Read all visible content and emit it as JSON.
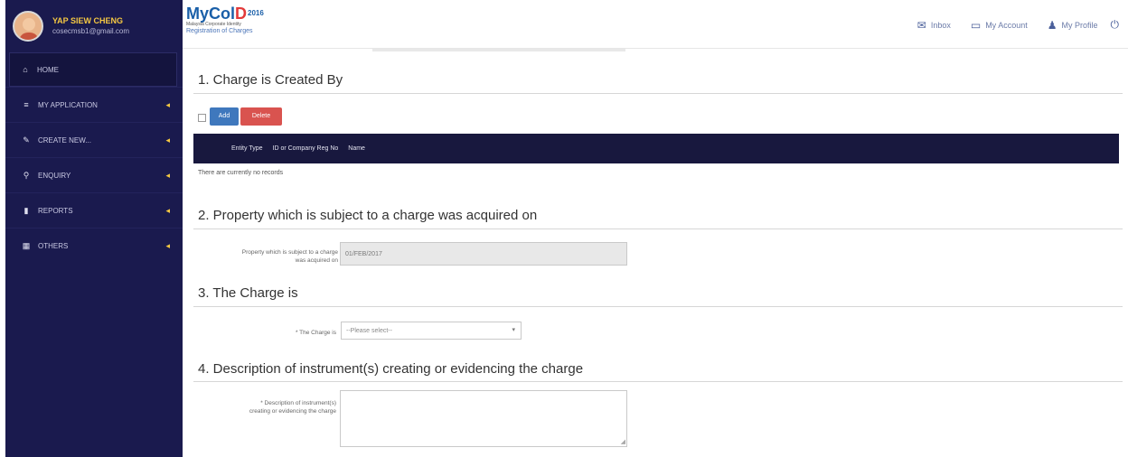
{
  "user": {
    "name": "YAP SIEW CHENG",
    "email": "cosecmsb1@gmail.com"
  },
  "sidebar": {
    "items": [
      {
        "label": "HOME",
        "icon": "home-icon",
        "has_arrow": false
      },
      {
        "label": "MY APPLICATION",
        "icon": "list-icon",
        "has_arrow": true
      },
      {
        "label": "CREATE NEW...",
        "icon": "edit-icon",
        "has_arrow": true
      },
      {
        "label": "ENQUIRY",
        "icon": "search-icon",
        "has_arrow": true
      },
      {
        "label": "REPORTS",
        "icon": "file-icon",
        "has_arrow": true
      },
      {
        "label": "OTHERS",
        "icon": "grid-icon",
        "has_arrow": true
      }
    ],
    "arrow_glyph": "◂"
  },
  "header": {
    "logo_text_a": "MyCol",
    "logo_text_b": "D",
    "logo_year": "2016",
    "logo_subtitle": "Malaysia Corporate Identity",
    "page_name": "Registration of Charges",
    "inbox_label": "Inbox",
    "account_label": "My Account",
    "profile_label": "My Profile"
  },
  "section1": {
    "title": "1. Charge is Created By",
    "add_label": "Add",
    "delete_label": "Delete",
    "columns": [
      "Entity Type",
      "ID or Company Reg No",
      "Name"
    ],
    "empty_text": "There are currently no records"
  },
  "section2": {
    "title": "2. Property which is subject to a charge was acquired on",
    "field_label_line1": "Property which is subject to a charge",
    "field_label_line2": "was acquired on",
    "field_value": "01/FEB/2017"
  },
  "section3": {
    "title": "3. The Charge is",
    "field_label": "* The Charge is",
    "select_value": "--Please select--"
  },
  "section4": {
    "title": "4. Description of instrument(s) creating or evidencing the charge",
    "field_label_line1": "* Description of instrument(s)",
    "field_label_line2": "creating or evidencing the charge"
  },
  "colors": {
    "sidebar_bg": "#1a1a4e",
    "accent_yellow": "#f5c842",
    "table_header_bg": "#18183e",
    "add_button": "#3f78bd",
    "delete_button": "#d9534f",
    "logo_blue": "#1a5fa8",
    "logo_red": "#e33a3a"
  }
}
